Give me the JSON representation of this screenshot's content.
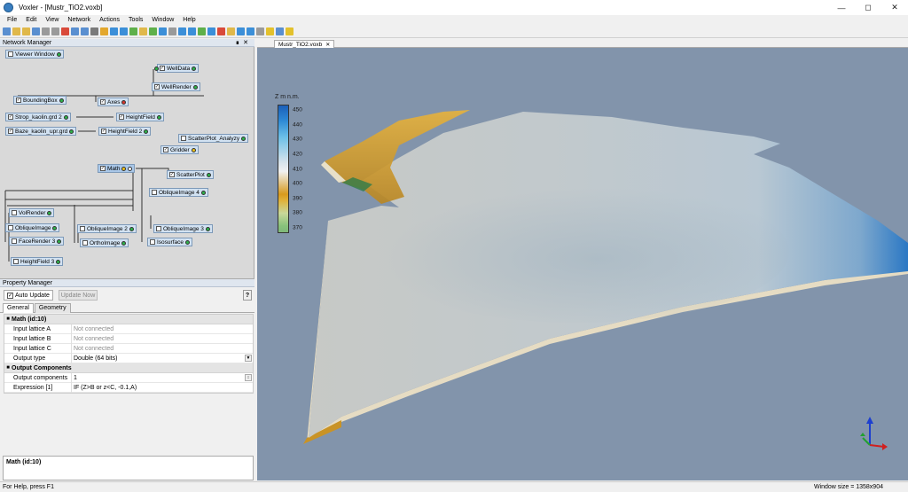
{
  "window": {
    "title": "Voxler - [Mustr_TiO2.voxb]"
  },
  "menu": [
    "File",
    "Edit",
    "View",
    "Network",
    "Actions",
    "Tools",
    "Window",
    "Help"
  ],
  "toolbar_colors": [
    "#5a8fd0",
    "#e0b84a",
    "#e0b84a",
    "#5a8fd0",
    "#9a9a9a",
    "#9a9a9a",
    "#d94a3a",
    "#5a8fd0",
    "#5a8fd0",
    "#7a7a7a",
    "#e3a72d",
    "#3c8fd8",
    "#3c8fd8",
    "#5fb04a",
    "#e0b84a",
    "#5fb04a",
    "#3c8fd8",
    "#9a9a9a",
    "#3c8fd8",
    "#3c8fd8",
    "#5fb04a",
    "#3c8fd8",
    "#d94a3a",
    "#e0b84a",
    "#3c8fd8",
    "#3c8fd8",
    "#9a9a9a",
    "#e3c12d",
    "#5a8fd0",
    "#e3c12d"
  ],
  "network_manager": {
    "title": "Network Manager",
    "nodes": {
      "viewer_window": "Viewer Window",
      "welldata": "WellData",
      "wellrender": "WellRender",
      "boundingbox": "BoundingBox",
      "axes": "Axes",
      "strop": "Strop_kaolin.grd 2",
      "heightfield": "HeightField",
      "baze": "Baze_kaolin_upr.grd",
      "heightfield2": "HeightField 2",
      "scatterplot_analyzer": "ScatterPlot_Analyzy",
      "gridder": "Gridder",
      "math": "Math",
      "scatterplot": "ScatterPlot",
      "obliqueimage4": "ObliqueImage 4",
      "volrender": "VolRender",
      "obliqueimage": "ObliqueImage",
      "obliqueimage2": "ObliqueImage 2",
      "obliqueimage3": "ObliqueImage 3",
      "facerender3": "FaceRender 3",
      "orthoimage": "OrthoImage",
      "isosurface": "Isosurface",
      "heightfield3": "HeightField 3"
    }
  },
  "property_manager": {
    "title": "Property Manager",
    "auto_update": "Auto Update",
    "update_now": "Update Now",
    "help": "?",
    "tabs": [
      "General",
      "Geometry"
    ],
    "section1": "Math (id:10)",
    "rows1": [
      {
        "key": "Input lattice A",
        "value": "Not connected"
      },
      {
        "key": "Input lattice B",
        "value": "Not connected"
      },
      {
        "key": "Input lattice C",
        "value": "Not connected"
      },
      {
        "key": "Output type",
        "value": "Double (64 bits)"
      }
    ],
    "section2": "Output Components",
    "rows2": [
      {
        "key": "Output components",
        "value": "1"
      },
      {
        "key": "Expression [1]",
        "value": "IF (Z>B or z<C, -0.1,A)"
      }
    ],
    "description": "Math (id:10)"
  },
  "viewer": {
    "tab": "Mustr_TiO2.voxb",
    "legend": {
      "title": "Z m n.m.",
      "ticks": [
        "450",
        "440",
        "430",
        "420",
        "410",
        "400",
        "390",
        "380",
        "370"
      ]
    }
  },
  "status": {
    "left": "For Help, press F1",
    "right": "Window size = 1358x904"
  }
}
